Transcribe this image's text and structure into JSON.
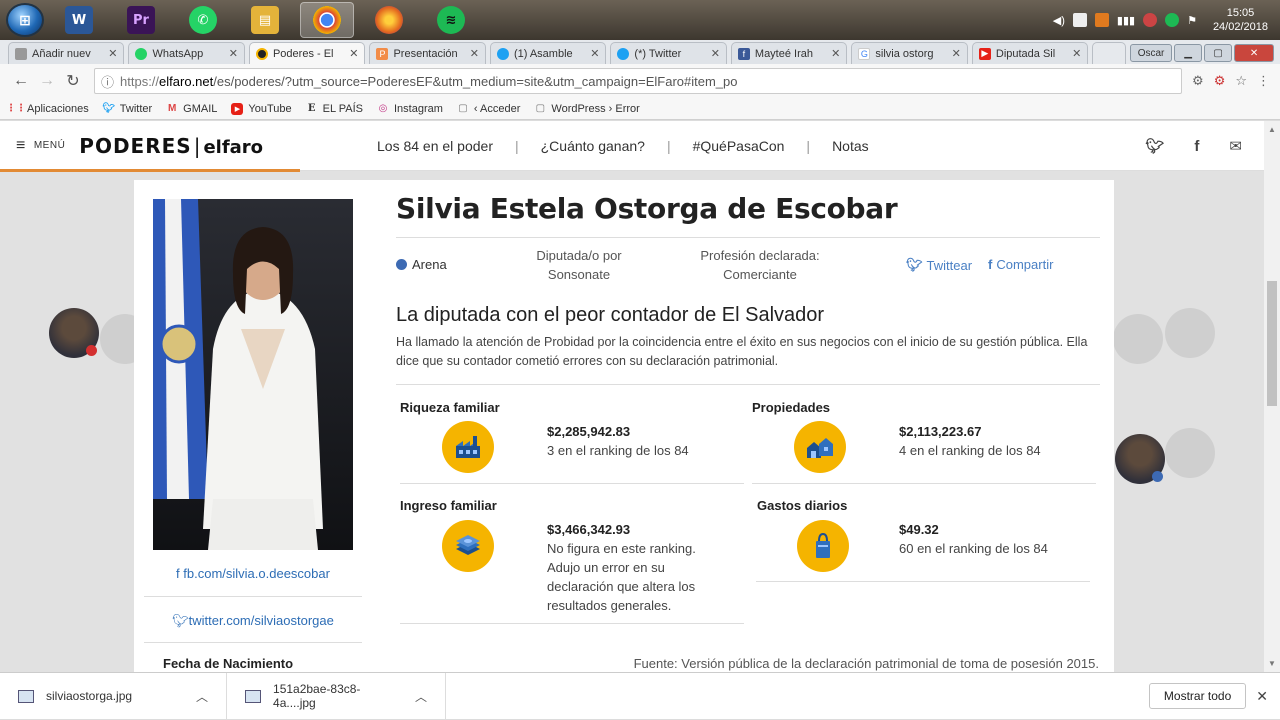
{
  "taskbar": {
    "start_label": "⊞",
    "apps": [
      {
        "name": "word",
        "label": "W",
        "color": "#2b5797"
      },
      {
        "name": "premiere",
        "label": "Pr",
        "color": "#3a1456"
      },
      {
        "name": "whatsapp",
        "label": "✆",
        "color": "#25d366"
      },
      {
        "name": "explorer",
        "label": "▤",
        "color": "#e4b33a"
      },
      {
        "name": "chrome",
        "label": "◉",
        "color": "#3d8f42"
      },
      {
        "name": "firefox",
        "label": "◕",
        "color": "#e46b1f"
      },
      {
        "name": "spotify",
        "label": "≋",
        "color": "#1db954"
      }
    ],
    "time": "15:05",
    "date": "24/02/2018"
  },
  "tabs": [
    {
      "title": "Añadir nuev",
      "fav": "▢",
      "fav_color": "#888"
    },
    {
      "title": "WhatsApp",
      "fav": "✆",
      "fav_color": "#25d366"
    },
    {
      "title": "Poderes - El",
      "fav": "●",
      "fav_color": "#222"
    },
    {
      "title": "Presentación",
      "fav": "P",
      "fav_color": "#f28c48"
    },
    {
      "title": "(1) Asamble",
      "fav": "t",
      "fav_color": "#1da1f2"
    },
    {
      "title": "(*) Twitter",
      "fav": "t",
      "fav_color": "#1da1f2"
    },
    {
      "title": "Mayteé Irah",
      "fav": "f",
      "fav_color": "#3b5998"
    },
    {
      "title": "silvia ostorg",
      "fav": "G",
      "fav_color": "#4285f4"
    },
    {
      "title": "Diputada Sil",
      "fav": "▶",
      "fav_color": "#e62117"
    }
  ],
  "window": {
    "user": "Oscar"
  },
  "address": {
    "scheme": "https://",
    "host": "elfaro.net",
    "path": "/es/poderes/?utm_source=PoderesEF&utm_medium=site&utm_campaign=ElFaro#item_po"
  },
  "bookmarks": [
    {
      "label": "Aplicaciones",
      "icon": "⋮⋮",
      "color": "#d44"
    },
    {
      "label": "Twitter",
      "icon": "t",
      "color": "#1da1f2"
    },
    {
      "label": "GMAIL",
      "icon": "M",
      "color": "#d44"
    },
    {
      "label": "YouTube",
      "icon": "▶",
      "color": "#e62117"
    },
    {
      "label": "EL PAÍS",
      "icon": "E",
      "color": "#111"
    },
    {
      "label": "Instagram",
      "icon": "◎",
      "color": "#c13584"
    },
    {
      "label": "‹ Acceder",
      "icon": "▢",
      "color": "#777"
    },
    {
      "label": "WordPress › Error",
      "icon": "▢",
      "color": "#777"
    }
  ],
  "site": {
    "menu_label": "MENÚ",
    "brand_a": "PODERES",
    "brand_b": "elfaro",
    "nav": [
      "Los 84 en el poder",
      "¿Cuánto ganan?",
      "#QuéPasaCon",
      "Notas"
    ],
    "accent": "#e28a34"
  },
  "profile": {
    "name": "Silvia Estela Ostorga de Escobar",
    "party": "Arena",
    "role_line1": "Diputada/o por",
    "role_line2": "Sonsonate",
    "prof_line1": "Profesión declarada:",
    "prof_line2": "Comerciante",
    "twittear": "Twittear",
    "compartir": "Compartir",
    "fb_link": "fb.com/silvia.o.deescobar",
    "tw_link": "twitter.com/silviaostorgae",
    "fecha_label": "Fecha de Nacimiento",
    "headline": "La diputada con el peor contador de El Salvador",
    "summary": "Ha llamado la atención de Probidad por la coincidencia entre el éxito en sus negocios con el inicio de su gestión pública. Ella dice que su contador cometió errores con su declaración patrimonial.",
    "source": "Fuente: Versión pública de la declaración patrimonial de toma de posesión 2015."
  },
  "stats": {
    "riqueza": {
      "title": "Riqueza familiar",
      "value": "$2,285,942.83",
      "rank": "3 en el ranking de los 84"
    },
    "propiedades": {
      "title": "Propiedades",
      "value": "$2,113,223.67",
      "rank": "4 en el ranking de los 84"
    },
    "ingreso": {
      "title": "Ingreso familiar",
      "value": "$3,466,342.93",
      "rank1": "No figura en este ranking.",
      "rank2": "Adujo un error en su",
      "rank3": "declaración que altera los",
      "rank4": "resultados generales."
    },
    "gastos": {
      "title": "Gastos diarios",
      "value": "$49.32",
      "rank": "60 en el ranking de los 84"
    },
    "icon_color": "#f5b400"
  },
  "downloads": {
    "items": [
      "silviaostorga.jpg",
      "151a2bae-83c8-4a....jpg"
    ],
    "show_all": "Mostrar todo"
  }
}
